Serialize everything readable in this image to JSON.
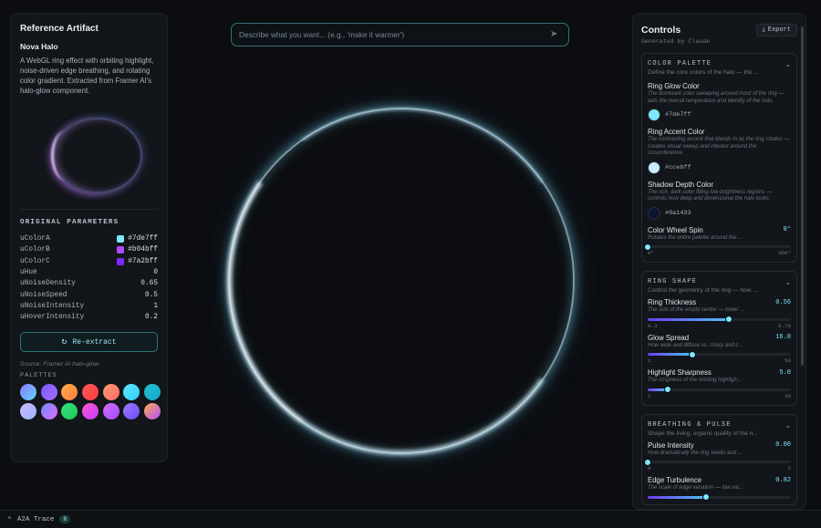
{
  "left": {
    "title": "Reference Artifact",
    "name": "Nova Halo",
    "description": "A WebGL ring effect with orbiting highlight, noise-driven edge breathing, and rotating color gradient. Extracted from Framer AI's halo-glow component.",
    "params_title": "ORIGINAL PARAMETERS",
    "params": [
      {
        "key": "uColorA",
        "value": "#7de7ff",
        "color": "#7de7ff"
      },
      {
        "key": "uColorB",
        "value": "#b04bff",
        "color": "#b04bff"
      },
      {
        "key": "uColorC",
        "value": "#7a2bff",
        "color": "#7a2bff"
      },
      {
        "key": "uHue",
        "value": "0"
      },
      {
        "key": "uNoiseDensity",
        "value": "0.65"
      },
      {
        "key": "uNoiseSpeed",
        "value": "0.5"
      },
      {
        "key": "uNoiseIntensity",
        "value": "1"
      },
      {
        "key": "uHoverIntensity",
        "value": "0.2"
      }
    ],
    "reextract_label": "Re-extract",
    "reextract_icon": "refresh-icon",
    "source": "Source: Framer AI halo-glow",
    "palettes_title": "PALETTES",
    "palettes": [
      [
        "#8b7bff",
        "#5fd4ff"
      ],
      [
        "#7a5cff",
        "#a56bff"
      ],
      [
        "#ffb14a",
        "#ff7a3d"
      ],
      [
        "#ff5a5a",
        "#ff3b3b"
      ],
      [
        "#ff9a6b",
        "#ff6a6a"
      ],
      [
        "#5ee6ff",
        "#2fd0ff"
      ],
      [
        "#22c0d8",
        "#18a6c4"
      ],
      [
        "#c8b6ff",
        "#9fb5ff"
      ],
      [
        "#6a8cff",
        "#e46bff"
      ],
      [
        "#35e07a",
        "#1ec85a"
      ],
      [
        "#ff5ad2",
        "#c03bff"
      ],
      [
        "#d36bff",
        "#a24bff"
      ],
      [
        "#9d7bff",
        "#6a4bff"
      ],
      [
        "#ffb14a",
        "#b04bff"
      ]
    ]
  },
  "prompt": {
    "placeholder": "Describe what you want... (e.g., 'make it warmer')",
    "send_icon": "send-icon"
  },
  "right": {
    "title": "Controls",
    "export_label": "Export",
    "export_icon": "download-icon",
    "generated_by": "Generated by Claude",
    "color_palette": {
      "title": "COLOR PALETTE",
      "desc": "Define the core colors of the halo — the ...",
      "ring_glow": {
        "name": "Ring Glow Color",
        "help": "The dominant color sweeping around most of the ring — sets the overall temperature and identity of the halo.",
        "hex": "#7de7ff",
        "color": "#7de7ff"
      },
      "ring_accent": {
        "name": "Ring Accent Color",
        "help": "The contrasting accent that blends in as the ring rotates — creates visual sweep and interest around the circumference.",
        "hex": "#ccebff",
        "color": "#ccebff"
      },
      "shadow": {
        "name": "Shadow Depth Color",
        "help": "The rich, dark color filling low-brightness regions — controls how deep and dimensional the halo looks.",
        "hex": "#0a1433",
        "color": "#0a1433"
      },
      "spin": {
        "name": "Color Wheel Spin",
        "value": "0°",
        "help": "Rotates the entire palette around the ...",
        "min": "0°",
        "max": "360°",
        "fraction": 0.0
      }
    },
    "ring_shape": {
      "title": "RING SHAPE",
      "desc": "Control the geometry of the ring — how ...",
      "thickness": {
        "name": "Ring Thickness",
        "value": "0.56",
        "help": "The size of the empty center — lower ...",
        "min": "0.3",
        "max": "0.76",
        "fraction": 0.57
      },
      "glow": {
        "name": "Glow Spread",
        "value": "16.0",
        "help": "How wide and diffuse vs. sharp and c...",
        "min": "1",
        "max": "50",
        "fraction": 0.31
      },
      "sharpness": {
        "name": "Highlight Sharpness",
        "value": "5.0",
        "help": "The crispness of the orbiting highligh...",
        "min": "1",
        "max": "30",
        "fraction": 0.14
      }
    },
    "breathing": {
      "title": "BREATHING & PULSE",
      "desc": "Shape the living, organic quality of the ri...",
      "pulse": {
        "name": "Pulse Intensity",
        "value": "0.00",
        "help": "How dramatically the ring swells and ...",
        "min": "0",
        "max": "2",
        "fraction": 0.0
      },
      "turbulence": {
        "name": "Edge Turbulence",
        "value": "0.82",
        "help": "The scale of edge variation — low val...",
        "fraction": 0.41
      }
    }
  },
  "bottom": {
    "label": "A2A Trace",
    "count": "8",
    "chevron_icon": "chevron-up-icon"
  }
}
